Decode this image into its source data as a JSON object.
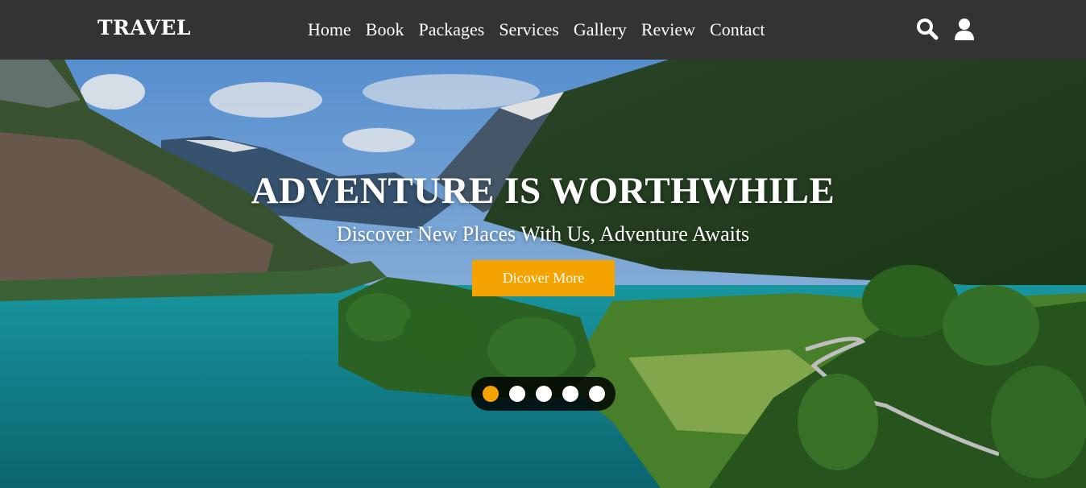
{
  "brand": {
    "logo": "TRAVEL"
  },
  "nav": {
    "items": [
      {
        "label": "Home"
      },
      {
        "label": "Book"
      },
      {
        "label": "Packages"
      },
      {
        "label": "Services"
      },
      {
        "label": "Gallery"
      },
      {
        "label": "Review"
      },
      {
        "label": "Contact"
      }
    ],
    "icons": [
      "search-icon",
      "user-icon"
    ]
  },
  "hero": {
    "title": "ADVENTURE IS WORTHWHILE",
    "subtitle": "Discover New Places With Us, Adventure Awaits",
    "cta_label": "Dicover More"
  },
  "slider": {
    "count": 5,
    "active_index": 0
  },
  "colors": {
    "nav_bg": "#333333",
    "accent": "#f5a300",
    "text": "#ffffff"
  }
}
